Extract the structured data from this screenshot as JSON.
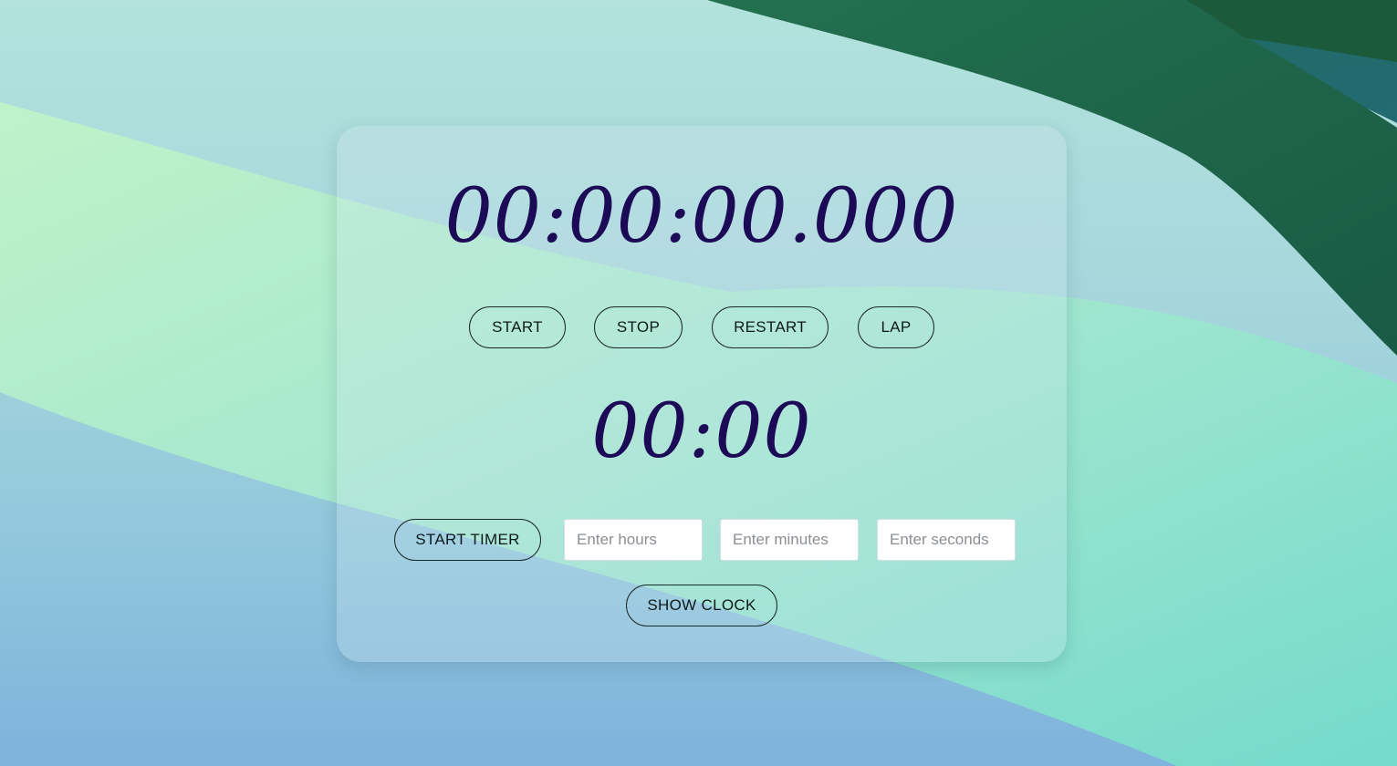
{
  "stopwatch": {
    "display": "00:00:00.000",
    "buttons": {
      "start": "START",
      "stop": "STOP",
      "restart": "RESTART",
      "lap": "LAP"
    }
  },
  "timer": {
    "display": "00:00",
    "start_label": "START TIMER",
    "hours_placeholder": "Enter hours",
    "minutes_placeholder": "Enter minutes",
    "seconds_placeholder": "Enter seconds"
  },
  "clock": {
    "show_label": "SHOW CLOCK"
  },
  "colors": {
    "display_text": "#1c0a56",
    "dark_green": "#1f6b52",
    "light_green": "#b9f2c8",
    "aqua": "#8fe3cf"
  }
}
